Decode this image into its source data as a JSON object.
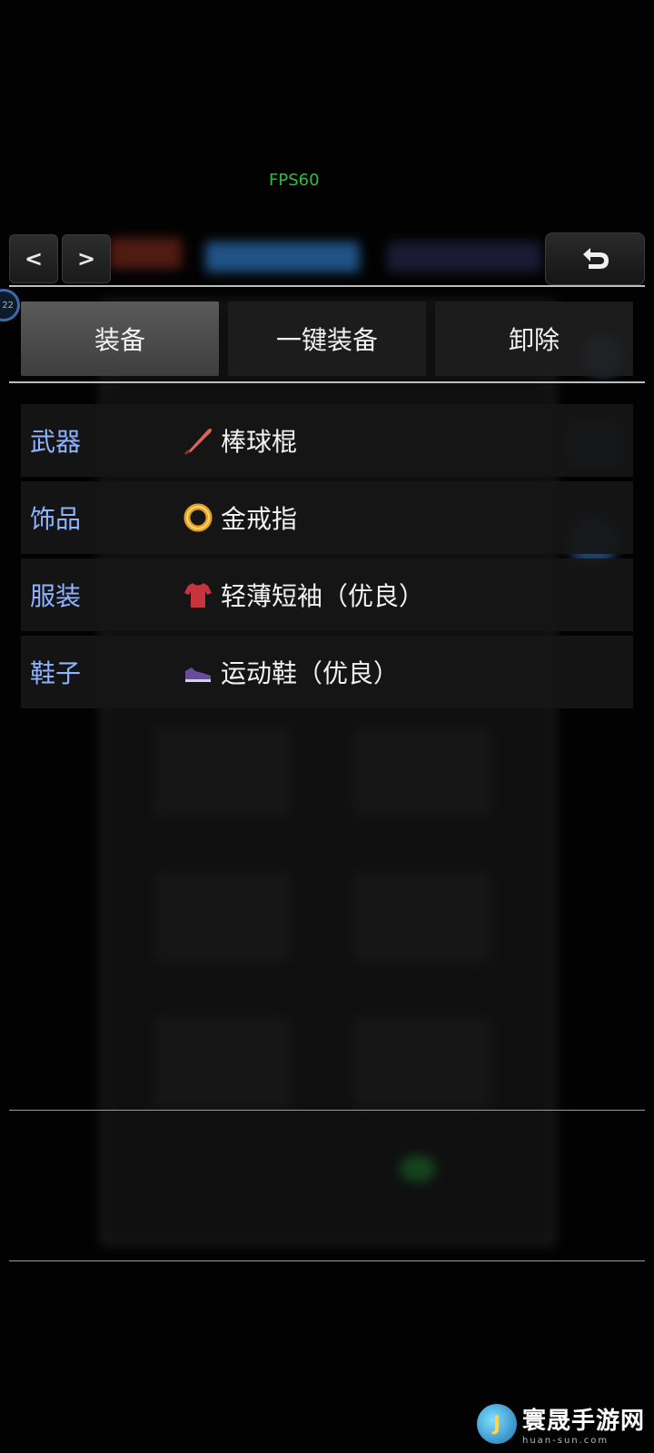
{
  "status": {
    "fps": "FPS60"
  },
  "top_bar": {
    "prev_label": "<",
    "next_label": ">",
    "back_icon": "return-arrow-icon"
  },
  "avatar": {
    "level": "22"
  },
  "tabs": [
    {
      "label": "装备",
      "active": true
    },
    {
      "label": "一键装备",
      "active": false
    },
    {
      "label": "卸除",
      "active": false
    }
  ],
  "equipment": [
    {
      "slot": "武器",
      "item": "棒球棍",
      "icon": "baseball-bat-icon"
    },
    {
      "slot": "饰品",
      "item": "金戒指",
      "icon": "gold-ring-icon"
    },
    {
      "slot": "服装",
      "item": "轻薄短袖（优良）",
      "icon": "shirt-icon"
    },
    {
      "slot": "鞋子",
      "item": "运动鞋（优良）",
      "icon": "sneaker-icon"
    }
  ],
  "watermark": {
    "title": "寰晟手游网",
    "subtitle": "huan-sun.com"
  },
  "colors": {
    "slot_label": "#8fb4ff",
    "fps": "#2fbf3f"
  }
}
